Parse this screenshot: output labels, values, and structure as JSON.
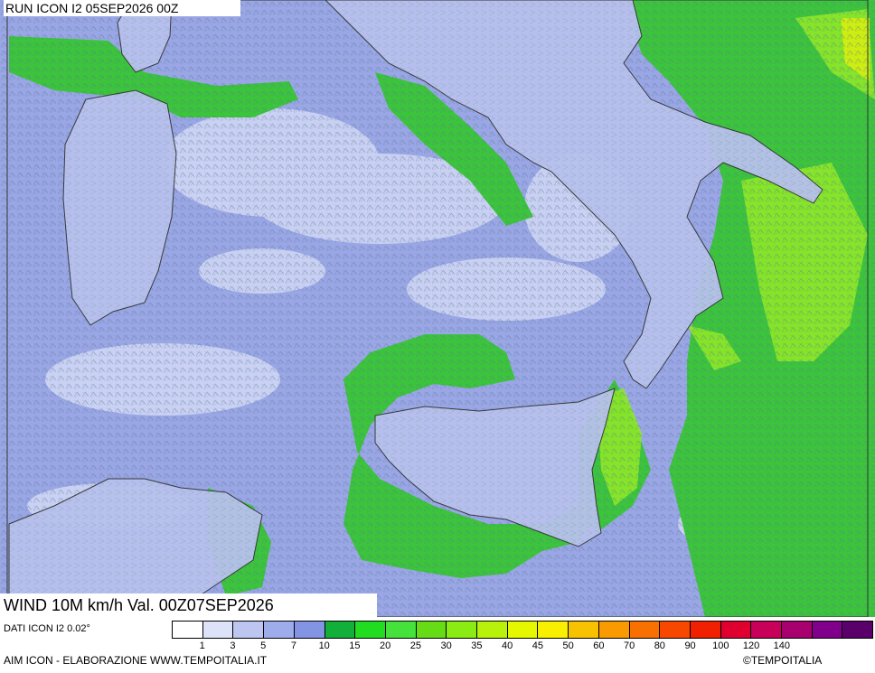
{
  "header": {
    "run_title": "RUN ICON I2 05SEP2026 00Z"
  },
  "footer": {
    "wind_title": "WIND 10M km/h Val. 00Z07SEP2026",
    "data_source": "DATI ICON I2 0.02°",
    "credit": "AIM ICON - ELABORAZIONE WWW.TEMPOITALIA.IT",
    "copyright": "©TEMPOITALIA"
  },
  "legend": {
    "colors": [
      "#ffffff",
      "#dde2f8",
      "#bcc6f0",
      "#9eacec",
      "#8494e4",
      "#12b03a",
      "#22dc22",
      "#44e23a",
      "#66dc16",
      "#8aec12",
      "#b8f20a",
      "#e6f800",
      "#f8f000",
      "#f8c200",
      "#f89a00",
      "#f87000",
      "#f84800",
      "#f02000",
      "#e00030",
      "#c8005a",
      "#a8006e",
      "#80008c",
      "#5a006a"
    ],
    "ticks": [
      "1",
      "3",
      "5",
      "7",
      "10",
      "15",
      "20",
      "25",
      "30",
      "35",
      "40",
      "45",
      "50",
      "60",
      "70",
      "80",
      "90",
      "100",
      "120",
      "140"
    ]
  },
  "map": {
    "sea_color": "#9aa6e6",
    "light_wind_color": "#d2d8f6",
    "moderate_wind_color": "#3cc43c",
    "strong_wind_color": "#8ee828",
    "land_border_color": "#333333"
  }
}
